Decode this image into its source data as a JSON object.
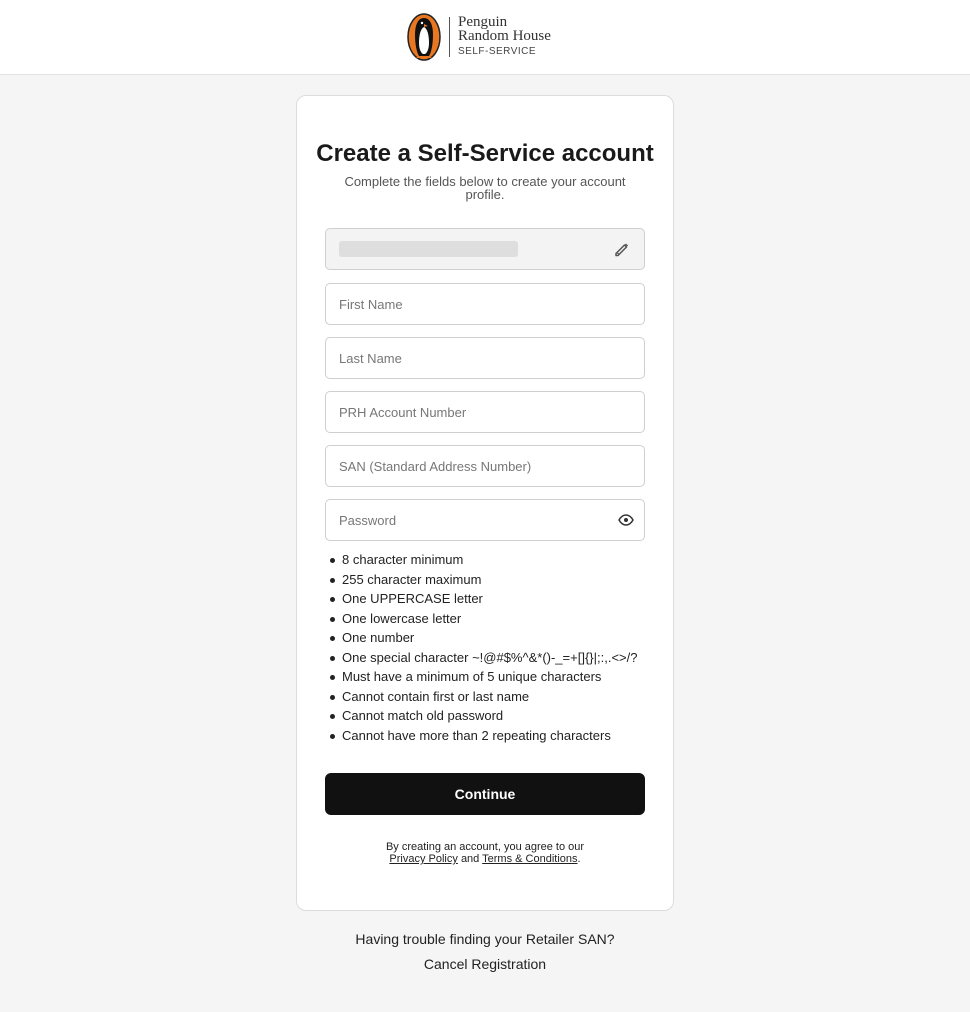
{
  "brand": {
    "line1": "Penguin",
    "line2": "Random House",
    "line3": "SELF-SERVICE",
    "logo_orange": "#e87722"
  },
  "card": {
    "title": "Create a Self-Service account",
    "subtitle": "Complete the fields below to create your account profile."
  },
  "fields": {
    "email_edit_icon": "pencil-icon",
    "first_name_placeholder": "First Name",
    "last_name_placeholder": "Last Name",
    "account_number_placeholder": "PRH Account Number",
    "san_placeholder": "SAN (Standard Address Number)",
    "password_placeholder": "Password",
    "password_toggle_icon": "eye-icon"
  },
  "password_rules": [
    "8 character minimum",
    "255 character maximum",
    "One UPPERCASE letter",
    "One lowercase letter",
    "One number",
    "One special character ~!@#$%^&*()-_=+[]{}|;:,.<>/?",
    "Must have a minimum of 5 unique characters",
    "Cannot contain first or last name",
    "Cannot match old password",
    "Cannot have more than 2 repeating characters"
  ],
  "continue_label": "Continue",
  "terms": {
    "prefix": "By creating an account, you agree to our",
    "privacy_link": "Privacy Policy",
    "and": "and",
    "terms_link": "Terms & Conditions",
    "suffix": "."
  },
  "footer_links": {
    "trouble": "Having trouble finding your Retailer SAN?",
    "cancel": "Cancel Registration"
  }
}
